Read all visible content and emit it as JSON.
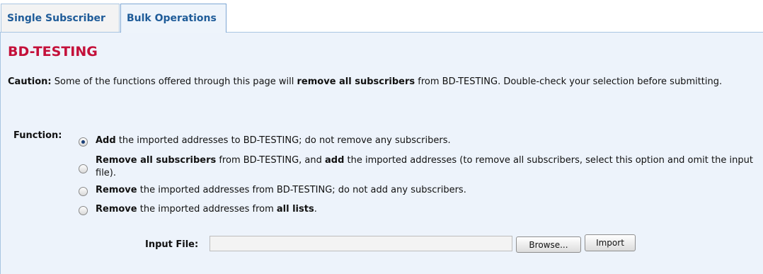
{
  "tabs": [
    {
      "label": "Single Subscriber",
      "active": false
    },
    {
      "label": "Bulk Operations",
      "active": true
    }
  ],
  "title": "BD-TESTING",
  "caution": {
    "label": "Caution:",
    "text_1": " Some of the functions offered through this page will ",
    "bold": "remove all subscribers",
    "text_2": " from BD-TESTING. Double-check your selection before submitting."
  },
  "function_label": "Function:",
  "options": [
    {
      "selected": true,
      "bold_1": "Add",
      "text_1": " the imported addresses to BD-TESTING; do not remove any subscribers.",
      "bold_2": "",
      "text_2": ""
    },
    {
      "selected": false,
      "bold_1": "Remove all subscribers",
      "text_1": " from BD-TESTING, and ",
      "bold_2": "add",
      "text_2": " the imported addresses (to remove all subscribers, select this option and omit the input file)."
    },
    {
      "selected": false,
      "bold_1": "Remove",
      "text_1": " the imported addresses from BD-TESTING; do not add any subscribers.",
      "bold_2": "",
      "text_2": ""
    },
    {
      "selected": false,
      "bold_1": "Remove",
      "text_1": " the imported addresses from ",
      "bold_2": "all lists",
      "text_2": "."
    }
  ],
  "input_file": {
    "label": "Input File:",
    "value": ""
  },
  "buttons": {
    "browse": "Browse...",
    "import": "Import"
  }
}
